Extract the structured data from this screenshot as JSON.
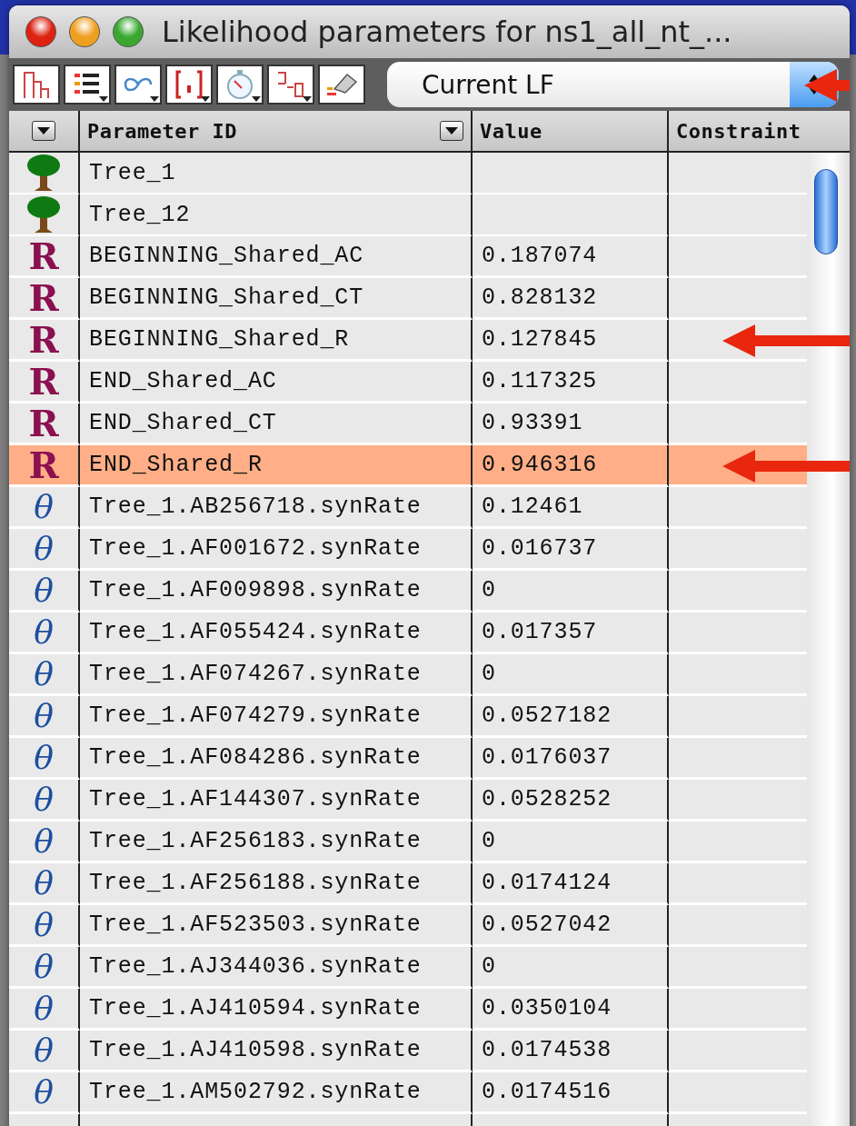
{
  "window": {
    "title": "Likelihood parameters for ns1_all_nt_..."
  },
  "toolbar": {
    "buttons": [
      {
        "kind": "tree",
        "menu": false
      },
      {
        "kind": "list",
        "menu": true
      },
      {
        "kind": "loop",
        "menu": true
      },
      {
        "kind": "bracket",
        "menu": true
      },
      {
        "kind": "timer",
        "menu": true
      },
      {
        "kind": "compare",
        "menu": true
      },
      {
        "kind": "eraser",
        "menu": false
      }
    ],
    "selector": {
      "value": "Current LF",
      "arrow": true
    }
  },
  "table": {
    "columns": [
      {
        "label": "Parameter ID",
        "menu": true
      },
      {
        "label": "Value",
        "menu": false
      },
      {
        "label": "Constraint",
        "menu": false
      }
    ],
    "rows": [
      {
        "kind": "tree",
        "id": "Tree_1",
        "selected": false,
        "arrow": false
      },
      {
        "kind": "tree",
        "id": "Tree_12",
        "selected": false,
        "arrow": false
      },
      {
        "kind": "global",
        "glyph": "R",
        "id": "BEGINNING_Shared_AC",
        "value": "0.187074",
        "selected": false,
        "arrow": false
      },
      {
        "kind": "global",
        "glyph": "R",
        "id": "BEGINNING_Shared_CT",
        "value": "0.828132",
        "selected": false,
        "arrow": false
      },
      {
        "kind": "global",
        "glyph": "R",
        "id": "BEGINNING_Shared_R",
        "value": "0.127845",
        "selected": false,
        "arrow": true
      },
      {
        "kind": "global",
        "glyph": "R",
        "id": "END_Shared_AC",
        "value": "0.117325",
        "selected": false,
        "arrow": false
      },
      {
        "kind": "global",
        "glyph": "R",
        "id": "END_Shared_CT",
        "value": "0.93391",
        "selected": false,
        "arrow": false
      },
      {
        "kind": "global",
        "glyph": "R",
        "id": "END_Shared_R",
        "value": "0.946316",
        "selected": true,
        "arrow": true
      },
      {
        "kind": "local",
        "glyph": "θ",
        "id": "Tree_1.AB256718.synRate",
        "value": "0.12461",
        "selected": false,
        "arrow": false
      },
      {
        "kind": "local",
        "glyph": "θ",
        "id": "Tree_1.AF001672.synRate",
        "value": "0.016737",
        "selected": false,
        "arrow": false
      },
      {
        "kind": "local",
        "glyph": "θ",
        "id": "Tree_1.AF009898.synRate",
        "value": "0",
        "selected": false,
        "arrow": false
      },
      {
        "kind": "local",
        "glyph": "θ",
        "id": "Tree_1.AF055424.synRate",
        "value": "0.017357",
        "selected": false,
        "arrow": false
      },
      {
        "kind": "local",
        "glyph": "θ",
        "id": "Tree_1.AF074267.synRate",
        "value": "0",
        "selected": false,
        "arrow": false
      },
      {
        "kind": "local",
        "glyph": "θ",
        "id": "Tree_1.AF074279.synRate",
        "value": "0.0527182",
        "selected": false,
        "arrow": false
      },
      {
        "kind": "local",
        "glyph": "θ",
        "id": "Tree_1.AF084286.synRate",
        "value": "0.0176037",
        "selected": false,
        "arrow": false
      },
      {
        "kind": "local",
        "glyph": "θ",
        "id": "Tree_1.AF144307.synRate",
        "value": "0.0528252",
        "selected": false,
        "arrow": false
      },
      {
        "kind": "local",
        "glyph": "θ",
        "id": "Tree_1.AF256183.synRate",
        "value": "0",
        "selected": false,
        "arrow": false
      },
      {
        "kind": "local",
        "glyph": "θ",
        "id": "Tree_1.AF256188.synRate",
        "value": "0.0174124",
        "selected": false,
        "arrow": false
      },
      {
        "kind": "local",
        "glyph": "θ",
        "id": "Tree_1.AF523503.synRate",
        "value": "0.0527042",
        "selected": false,
        "arrow": false
      },
      {
        "kind": "local",
        "glyph": "θ",
        "id": "Tree_1.AJ344036.synRate",
        "value": "0",
        "selected": false,
        "arrow": false
      },
      {
        "kind": "local",
        "glyph": "θ",
        "id": "Tree_1.AJ410594.synRate",
        "value": "0.0350104",
        "selected": false,
        "arrow": false
      },
      {
        "kind": "local",
        "glyph": "θ",
        "id": "Tree_1.AJ410598.synRate",
        "value": "0.0174538",
        "selected": false,
        "arrow": false
      },
      {
        "kind": "local",
        "glyph": "θ",
        "id": "Tree_1.AM502792.synRate",
        "value": "0.0174516",
        "selected": false,
        "arrow": false
      }
    ]
  }
}
